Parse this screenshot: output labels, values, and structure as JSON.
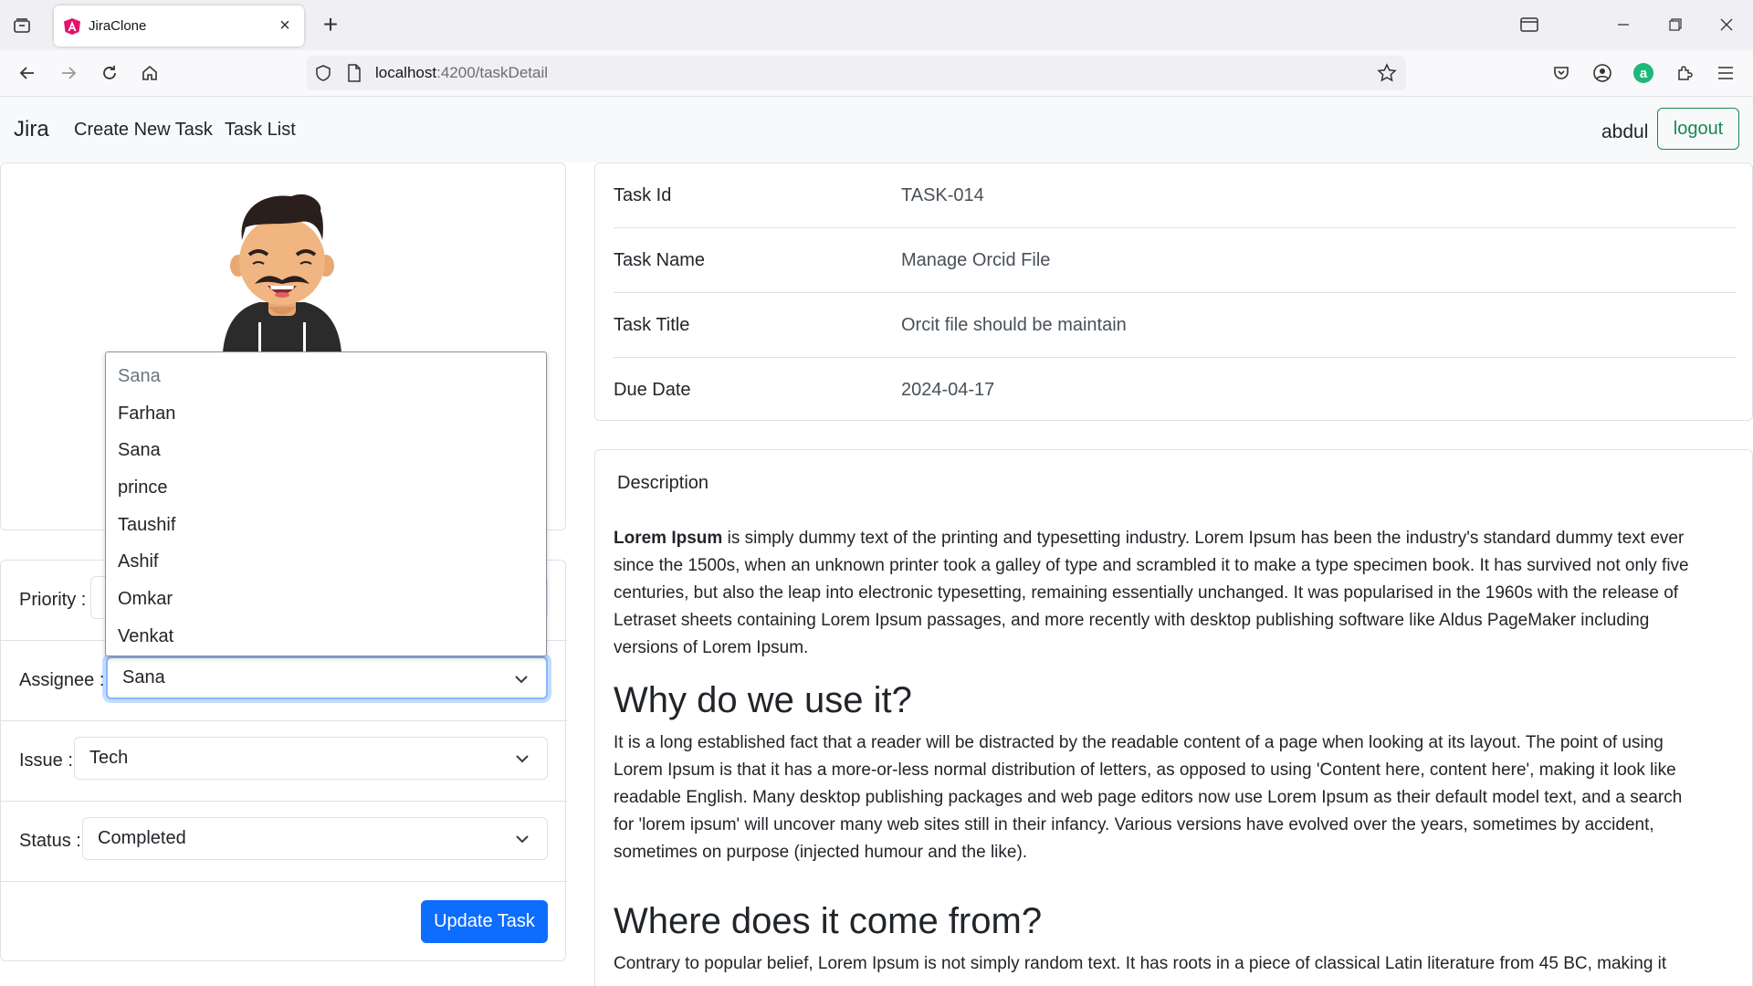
{
  "browser": {
    "tab_title": "JiraClone",
    "url_host": "localhost",
    "url_rest": ":4200/taskDetail",
    "icons": [
      "tab-list-icon",
      "angular-icon",
      "close-icon",
      "plus-icon",
      "back-icon",
      "forward-icon",
      "reload-icon",
      "home-icon",
      "shield-icon",
      "page-icon",
      "star-icon",
      "pocket-icon",
      "account-icon",
      "extension-a-icon",
      "puzzle-icon",
      "menu-icon",
      "minimize-icon",
      "restore-icon",
      "window-close-icon"
    ]
  },
  "app_nav": {
    "brand": "Jira",
    "links": [
      "Create New Task",
      "Task List"
    ],
    "username": "abdul",
    "logout": "logout"
  },
  "form": {
    "priority_label": "Priority :",
    "assignee_label": "Assignee :",
    "assignee_value": "Sana",
    "issue_label": "Issue :",
    "issue_value": "Tech",
    "status_label": "Status :",
    "status_value": "Completed",
    "update_button": "Update Task"
  },
  "assignee_dropdown": {
    "options": [
      "Sana",
      "Farhan",
      "Sana",
      "prince",
      "Taushif",
      "Ashif",
      "Omkar",
      "Venkat"
    ]
  },
  "task": {
    "rows": [
      {
        "key": "Task Id",
        "value": "TASK-014"
      },
      {
        "key": "Task Name",
        "value": "Manage Orcid File"
      },
      {
        "key": "Task Title",
        "value": "Orcit file should be maintain"
      },
      {
        "key": "Due Date",
        "value": "2024-04-17"
      }
    ]
  },
  "description": {
    "title": "Description",
    "p1_bold": "Lorem Ipsum",
    "p1_rest": " is simply dummy text of the printing and typesetting industry. Lorem Ipsum has been the industry's standard dummy text ever since the 1500s, when an unknown printer took a galley of type and scrambled it to make a type specimen book. It has survived not only five centuries, but also the leap into electronic typesetting, remaining essentially unchanged. It was popularised in the 1960s with the release of Letraset sheets containing Lorem Ipsum passages, and more recently with desktop publishing software like Aldus PageMaker including versions of Lorem Ipsum.",
    "h2_1": "Why do we use it?",
    "p2": "It is a long established fact that a reader will be distracted by the readable content of a page when looking at its layout. The point of using Lorem Ipsum is that it has a more-or-less normal distribution of letters, as opposed to using 'Content here, content here', making it look like readable English. Many desktop publishing packages and web page editors now use Lorem Ipsum as their default model text, and a search for 'lorem ipsum' will uncover many web sites still in their infancy. Various versions have evolved over the years, sometimes by accident, sometimes on purpose (injected humour and the like).",
    "h2_2": "Where does it come from?",
    "p3": "Contrary to popular belief, Lorem Ipsum is not simply random text. It has roots in a piece of classical Latin literature from 45 BC, making it"
  },
  "colors": {
    "primary": "#0d6efd",
    "success": "#198754",
    "focus_ring": "#86b7fe"
  }
}
